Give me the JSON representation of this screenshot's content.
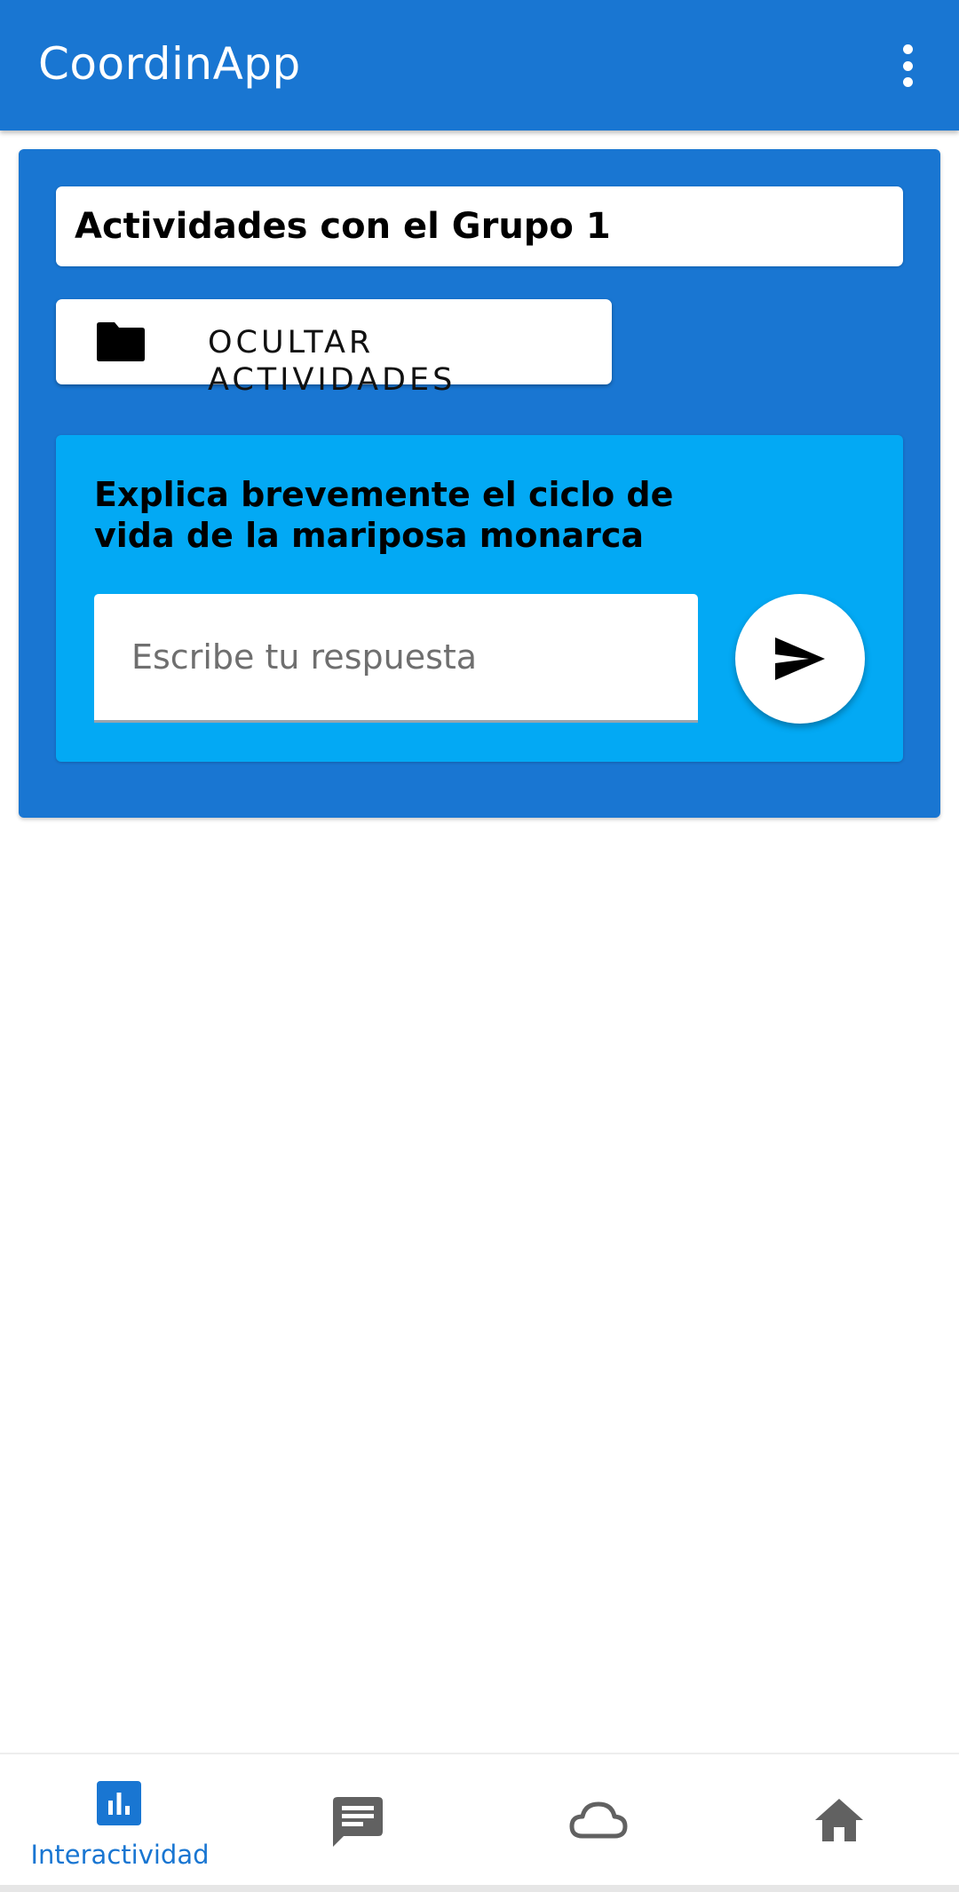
{
  "app": {
    "title": "CoordinApp"
  },
  "card": {
    "group_title": "Actividades con el Grupo 1",
    "hide_button_label": "OCULTAR ACTIVIDADES",
    "question": {
      "text": "Explica brevemente el ciclo de vida de la mariposa monarca",
      "answer_placeholder": "Escribe tu respuesta"
    }
  },
  "bottom_nav": {
    "items": [
      {
        "icon": "bar-chart-icon",
        "label": "Interactividad",
        "active": true
      },
      {
        "icon": "chat-icon",
        "label": "",
        "active": false
      },
      {
        "icon": "cloud-icon",
        "label": "",
        "active": false
      },
      {
        "icon": "home-icon",
        "label": "",
        "active": false
      }
    ]
  },
  "colors": {
    "primary": "#1976d2",
    "panel": "#03a9f4",
    "inactive_icon": "#616161",
    "active_label": "#1976d2"
  }
}
